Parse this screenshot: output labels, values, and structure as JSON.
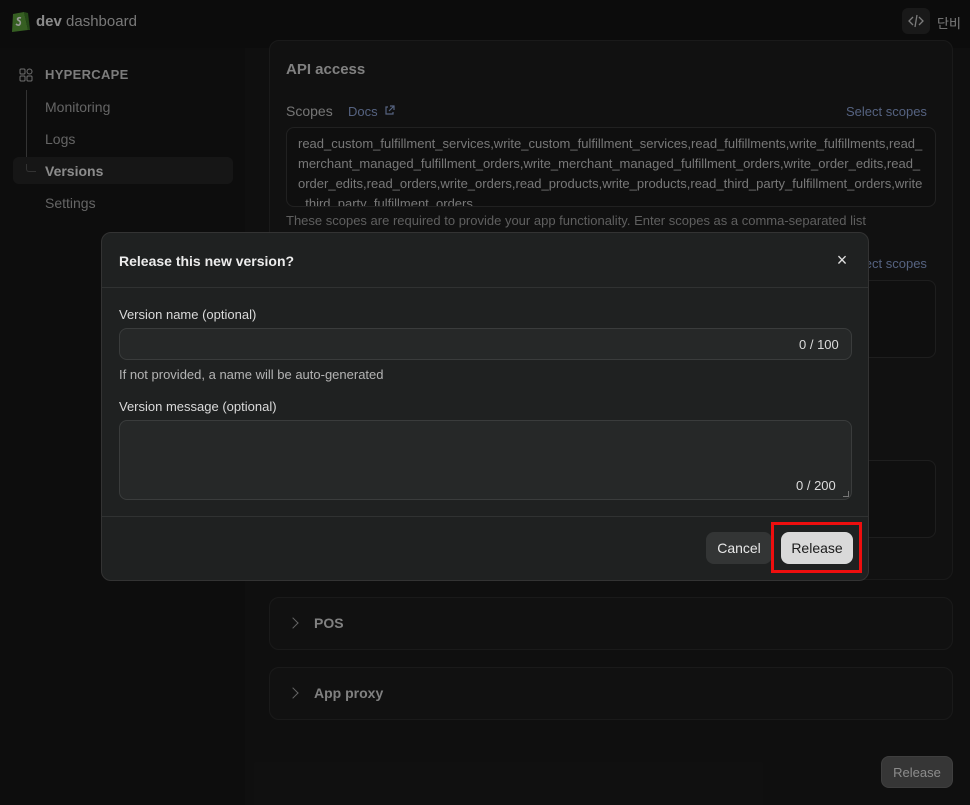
{
  "topbar": {
    "app_title_bold": "dev",
    "app_title_rest": "dashboard",
    "user": "단비"
  },
  "sidebar": {
    "store": "HYPERCAPE",
    "items": [
      {
        "label": "Monitoring"
      },
      {
        "label": "Logs"
      },
      {
        "label": "Versions"
      },
      {
        "label": "Settings"
      }
    ],
    "active": "Versions"
  },
  "api_access": {
    "title": "API access",
    "scopes_label": "Scopes",
    "docs_label": "Docs",
    "select_scopes": "Select scopes",
    "scopes_value": "read_custom_fulfillment_services,write_custom_fulfillment_services,read_fulfillments,write_fulfillments,read_merchant_managed_fulfillment_orders,write_merchant_managed_fulfillment_orders,write_order_edits,read_order_edits,read_orders,write_orders,read_products,write_products,read_third_party_fulfillment_orders,write_third_party_fulfillment_orders",
    "scopes_help": "These scopes are required to provide your app functionality. Enter scopes as a comma-separated list",
    "select_scopes_2": "Select scopes"
  },
  "sections": [
    {
      "label": "POS"
    },
    {
      "label": "App proxy"
    }
  ],
  "bottom_release": "Release",
  "modal": {
    "title": "Release this new version?",
    "close": "×",
    "name_label": "Version name (optional)",
    "name_counter": "0 / 100",
    "name_help": "If not provided, a name will be auto-generated",
    "message_label": "Version message (optional)",
    "message_counter": "0 / 200",
    "cancel": "Cancel",
    "release": "Release"
  },
  "colors": {
    "highlight": "#ee0e0e",
    "brand": "#5a9e3a"
  }
}
